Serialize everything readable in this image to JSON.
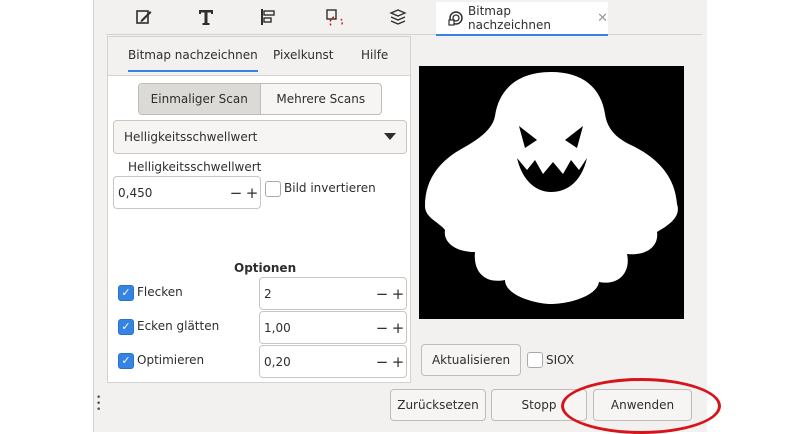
{
  "dock": {
    "icons": [
      "pen-edit-icon",
      "text-tool-icon",
      "align-icon",
      "transform-icon",
      "layers-icon"
    ],
    "active_tab_label": "Bitmap nachzeichnen",
    "active_tab_icon": "trace-bitmap-icon"
  },
  "inner_tabs": [
    {
      "label": "Bitmap nachzeichnen",
      "active": true
    },
    {
      "label": "Pixelkunst",
      "active": false
    },
    {
      "label": "Hilfe",
      "active": false
    }
  ],
  "scan_mode": {
    "options": [
      "Einmaliger Scan",
      "Mehrere Scans"
    ],
    "selected": "Einmaliger Scan"
  },
  "detection_mode": "Helligkeitsschwellwert",
  "threshold": {
    "label": "Helligkeitsschwellwert",
    "value": "0,450",
    "invert_label": "Bild invertieren",
    "invert_checked": false
  },
  "options": {
    "title": "Optionen",
    "rows": [
      {
        "label": "Flecken",
        "checked": true,
        "value": "2"
      },
      {
        "label": "Ecken glätten",
        "checked": true,
        "value": "1,00"
      },
      {
        "label": "Optimieren",
        "checked": true,
        "value": "0,20"
      }
    ]
  },
  "preview": {
    "update_label": "Aktualisieren",
    "siox_label": "SIOX",
    "siox_checked": false
  },
  "actions": {
    "reset": "Zurücksetzen",
    "stop": "Stopp",
    "apply": "Anwenden"
  },
  "colors": {
    "accent": "#3584e4",
    "annotation": "#d8141b"
  }
}
